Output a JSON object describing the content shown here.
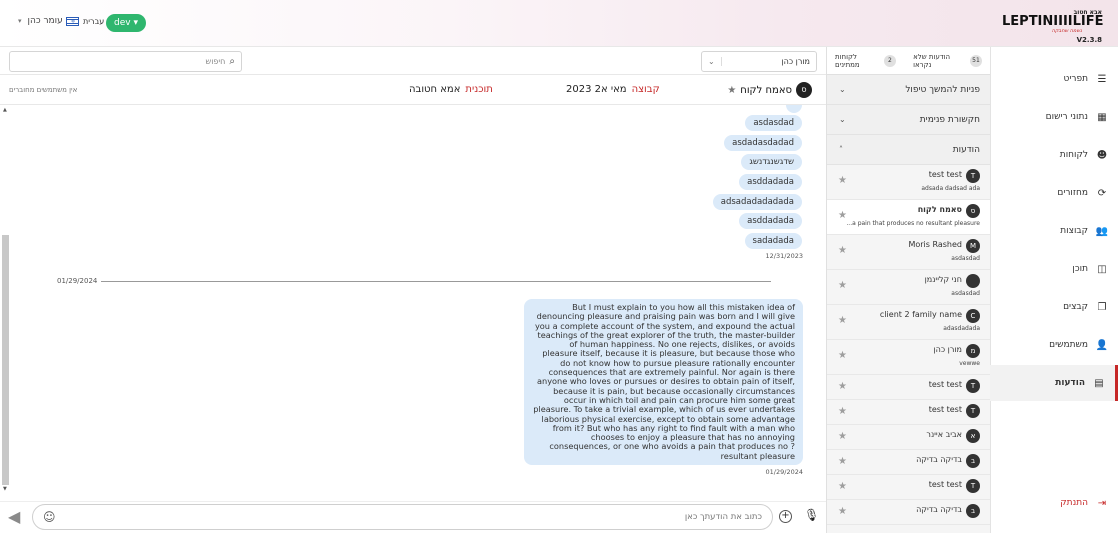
{
  "header": {
    "user_name": "עומר כהן",
    "language": "עברית",
    "env_badge": "dev",
    "logo_top": "אבא חטוב",
    "logo_brand": "LEPTINIIIILIFE",
    "logo_tagline": "נשמה שחבקה",
    "version": "V2.3.8"
  },
  "sidebar": {
    "items": [
      {
        "label": "תפריט",
        "icon": "hamburger-icon"
      },
      {
        "label": "נתוני רישום",
        "icon": "grid-icon"
      },
      {
        "label": "לקוחות",
        "icon": "face-icon"
      },
      {
        "label": "מחזורים",
        "icon": "cycle-icon"
      },
      {
        "label": "קבוצות",
        "icon": "group-icon"
      },
      {
        "label": "תוכן",
        "icon": "book-icon"
      },
      {
        "label": "קבצים",
        "icon": "file-icon"
      },
      {
        "label": "משתמשים",
        "icon": "person-icon"
      },
      {
        "label": "הודעות",
        "icon": "chat-icon"
      }
    ],
    "active": "הודעות",
    "logout": "התנתק"
  },
  "convlist": {
    "unread_count": "51",
    "unread_label": "הודעות שלא נקראו",
    "clients_count": "2",
    "clients_label": "לקוחות ממתינים",
    "sections": [
      {
        "label": "פניות להמשך טיפול",
        "chevron": "⌄"
      },
      {
        "label": "חקשורת פנימית",
        "chevron": "⌄"
      },
      {
        "label": "הודעות",
        "chevron": "˄"
      }
    ],
    "conversations": [
      {
        "initial": "T",
        "name": "test test",
        "preview": "adsada dadsad ada"
      },
      {
        "initial": "ס",
        "name": "סאמח לקוח",
        "preview": "...a pain that produces no resultant pleasure"
      },
      {
        "initial": "M",
        "name": "Moris Rashed",
        "preview": "asdasdad"
      },
      {
        "initial": "",
        "name": "חני קליינמן",
        "preview": "asdasdad"
      },
      {
        "initial": "C",
        "name": "client 2 family name",
        "preview": "adasdadada"
      },
      {
        "initial": "מ",
        "name": "מורן כהן",
        "preview": "vewwe"
      },
      {
        "initial": "T",
        "name": "test test",
        "preview": ""
      },
      {
        "initial": "T",
        "name": "test test",
        "preview": ""
      },
      {
        "initial": "א",
        "name": "אביב איינר",
        "preview": ""
      },
      {
        "initial": "ב",
        "name": "בדיקה בדיקה",
        "preview": ""
      },
      {
        "initial": "T",
        "name": "test test",
        "preview": ""
      },
      {
        "initial": "ב",
        "name": "בדיקה בדיקה",
        "preview": ""
      }
    ]
  },
  "chat": {
    "search_placeholder": "חיפוש",
    "agent_select": "מורן כהן",
    "contact_initial": "ס",
    "contact_name": "סאמח לקוח",
    "group_label": "קבוצה",
    "group_value": "מאי א2 2023",
    "program_label": "תוכנית",
    "program_value": "אמא חטובה",
    "no_users": "אין משתמשים מחוברים",
    "short_messages": [
      "asdasdad",
      "asdadasdadad",
      "שדגשנגדנשג",
      "asddadada",
      "adsadadadadada",
      "asddadada",
      "sadadada"
    ],
    "short_messages_date": "12/31/2023",
    "divider_date": "01/29/2024",
    "long_message": "But I must explain to you how all this mistaken idea of denouncing pleasure and praising pain was born and I will give you a complete account of the system, and expound the actual teachings of the great explorer of the truth, the master-builder of human happiness. No one rejects, dislikes, or avoids pleasure itself, because it is pleasure, but because those who do not know how to pursue pleasure rationally encounter consequences that are extremely painful. Nor again is there anyone who loves or pursues or desires to obtain pain of itself, because it is pain, but because occasionally circumstances occur in which toil and pain can procure him some great pleasure. To take a trivial example, which of us ever undertakes laborious physical exercise, except to obtain some advantage from it? But who has any right to find fault with a man who chooses to enjoy a pleasure that has no annoying consequences, or one who avoids a pain that produces no ?resultant pleasure",
    "long_message_date": "01/29/2024",
    "composer_placeholder": "כתוב את הודעתך כאן"
  },
  "colors": {
    "accent": "#c62828",
    "bubble": "#dbeaf9",
    "badge": "#2fb66e"
  }
}
